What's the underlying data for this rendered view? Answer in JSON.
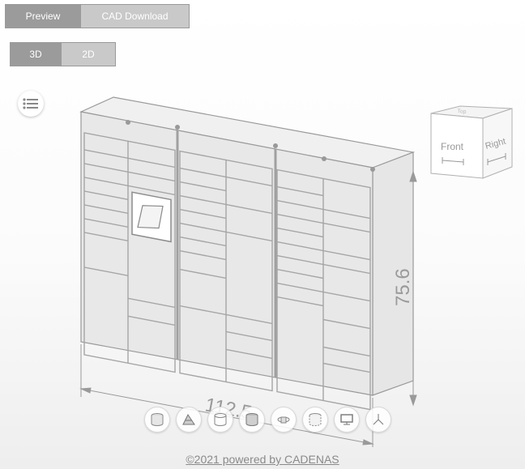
{
  "tabs": {
    "preview_label": "Preview",
    "cad_label": "CAD Download"
  },
  "view_tabs": {
    "three_d_label": "3D",
    "two_d_label": "2D"
  },
  "dimensions": {
    "width_label": "112.5",
    "height_label": "75.6"
  },
  "viewcube": {
    "front_label": "Front",
    "right_label": "Right",
    "top_label": "Top"
  },
  "toolbar": {
    "buttons": [
      "shaded-view-icon",
      "section-view-icon",
      "wireframe-view-icon",
      "solid-view-icon",
      "rotate-view-icon",
      "hidden-lines-icon",
      "fullscreen-monitor-icon",
      "axis-icon"
    ]
  },
  "footer": {
    "copyright": "©2021 powered by CADENAS"
  },
  "colors": {
    "active_tab": "#9b9b9b",
    "inactive_tab": "#c9c9c9",
    "model_line": "#9a9a9a"
  }
}
